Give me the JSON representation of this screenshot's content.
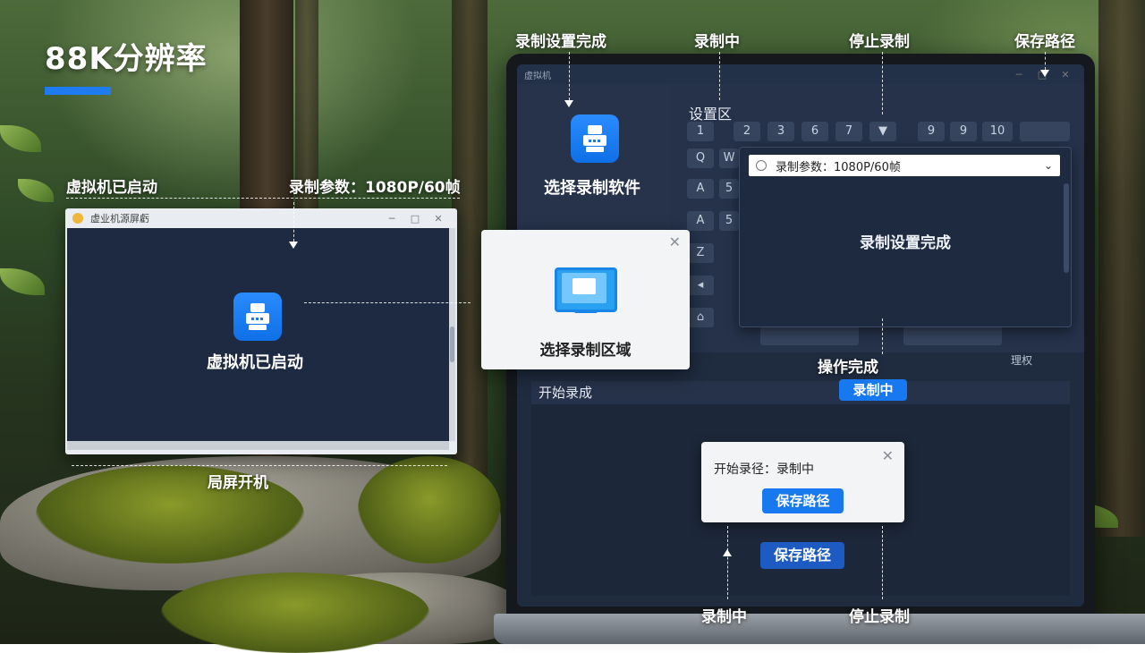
{
  "page": {
    "title": "88K分辨率"
  },
  "callouts": {
    "vm_started": "虚拟机已启动",
    "record_params": "录制参数：1080P/60帧",
    "power_on": "局屏开机",
    "record_setup_done": "录制设置完成",
    "recording_top": "录制中",
    "stop_record_top": "停止录制",
    "save_path_top": "保存路径",
    "operation_done": "操作完成",
    "recording_bottom": "录制中",
    "stop_record_bottom": "停止录制"
  },
  "vm_window": {
    "title": "虚业机源屏虧",
    "tile_label": "虚拟机已启动"
  },
  "region_card": {
    "label": "选择录制区域"
  },
  "laptop": {
    "title": "虚拟机",
    "software_label": "选择录制软件",
    "settings_title": "设置区",
    "keys_row1": [
      "1",
      "2",
      "3",
      "6",
      "7",
      "9",
      "9",
      "10"
    ],
    "keys_col": [
      "Q",
      "A",
      "A",
      "Z"
    ],
    "keys_col2": [
      "W",
      "5",
      "5"
    ],
    "param_select": "录制参数：1080P/60帧",
    "param_done": "录制设置完成",
    "misc_text": "理权",
    "record_header": "开始录成",
    "recording_badge": "录制中",
    "path_dialog_text": "开始录径：录制中",
    "path_dialog_button": "保存路径",
    "save_path_button": "保存路径"
  },
  "colors": {
    "accent": "#1e7bf0",
    "screen_bg": "#1f2b3f",
    "vm_bg": "#1e2a42"
  }
}
